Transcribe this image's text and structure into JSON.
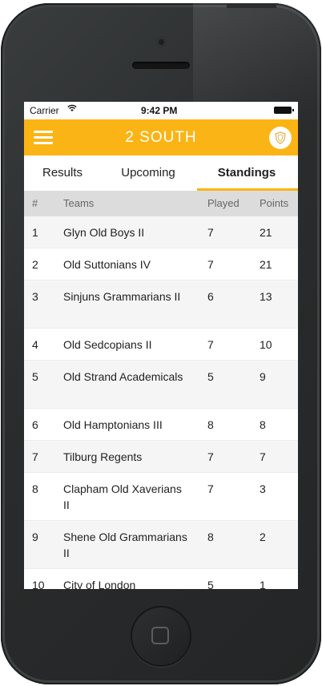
{
  "status_bar": {
    "carrier": "Carrier",
    "time": "9:42 PM"
  },
  "header": {
    "title": "2 SOUTH"
  },
  "tabs": [
    {
      "label": "Results"
    },
    {
      "label": "Upcoming"
    },
    {
      "label": "Standings",
      "active": true
    }
  ],
  "columns": {
    "rank": "#",
    "team": "Teams",
    "played": "Played",
    "points": "Points"
  },
  "standings": [
    {
      "rank": "1",
      "team": "Glyn Old Boys II",
      "played": "7",
      "points": "21"
    },
    {
      "rank": "2",
      "team": "Old Suttonians IV",
      "played": "7",
      "points": "21"
    },
    {
      "rank": "3",
      "team": "Sinjuns Grammarians II",
      "played": "6",
      "points": "13"
    },
    {
      "rank": "4",
      "team": "Old Sedcopians II",
      "played": "7",
      "points": "10"
    },
    {
      "rank": "5",
      "team": "Old Strand Academicals",
      "played": "5",
      "points": "9"
    },
    {
      "rank": "6",
      "team": "Old Hamptonians III",
      "played": "8",
      "points": "8"
    },
    {
      "rank": "7",
      "team": "Tilburg Regents",
      "played": "7",
      "points": "7"
    },
    {
      "rank": "8",
      "team": "Clapham Old Xaverians II",
      "played": "7",
      "points": "3"
    },
    {
      "rank": "9",
      "team": "Shene Old Grammarians II",
      "played": "8",
      "points": "2"
    },
    {
      "rank": "10",
      "team": "City of London",
      "played": "5",
      "points": "1"
    }
  ],
  "colors": {
    "accent": "#fbb415",
    "header_row": "#dcdcdc",
    "alt_row": "#f5f5f5"
  }
}
